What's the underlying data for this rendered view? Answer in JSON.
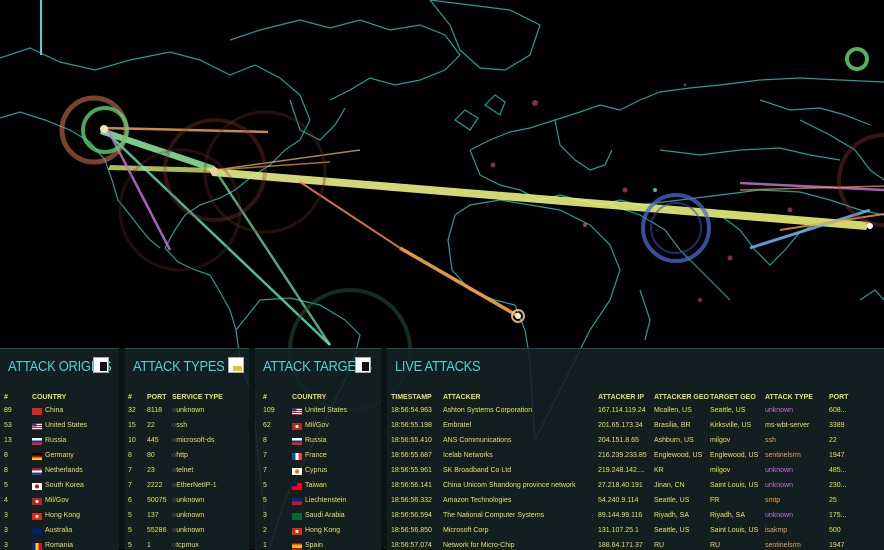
{
  "panels": {
    "origins": {
      "title": "ATTACK ORIGINS",
      "headers": [
        "#",
        "COUNTRY"
      ],
      "rows": [
        {
          "count": "89",
          "country": "China",
          "flag": "cn"
        },
        {
          "count": "53",
          "country": "United States",
          "flag": "us"
        },
        {
          "count": "13",
          "country": "Russia",
          "flag": "ru"
        },
        {
          "count": "8",
          "country": "Germany",
          "flag": "de"
        },
        {
          "count": "8",
          "country": "Netherlands",
          "flag": "nl"
        },
        {
          "count": "5",
          "country": "South Korea",
          "flag": "kr"
        },
        {
          "count": "4",
          "country": "Mil/Gov",
          "flag": "mil"
        },
        {
          "count": "3",
          "country": "Hong Kong",
          "flag": "hk"
        },
        {
          "count": "3",
          "country": "Australia",
          "flag": "au"
        },
        {
          "count": "3",
          "country": "Romania",
          "flag": "ro"
        }
      ]
    },
    "types": {
      "title": "ATTACK TYPES",
      "headers": [
        "#",
        "PORT",
        "SERVICE TYPE"
      ],
      "rows": [
        {
          "count": "32",
          "port": "8118",
          "service": "unknown"
        },
        {
          "count": "15",
          "port": "22",
          "service": "ssh"
        },
        {
          "count": "10",
          "port": "445",
          "service": "microsoft-ds"
        },
        {
          "count": "8",
          "port": "80",
          "service": "http"
        },
        {
          "count": "7",
          "port": "23",
          "service": "telnet"
        },
        {
          "count": "7",
          "port": "2222",
          "service": "EtherNetIP-1"
        },
        {
          "count": "6",
          "port": "50075",
          "service": "unknown"
        },
        {
          "count": "5",
          "port": "137",
          "service": "unknown"
        },
        {
          "count": "5",
          "port": "55286",
          "service": "unknown"
        },
        {
          "count": "5",
          "port": "1",
          "service": "tcpmux"
        }
      ]
    },
    "targets": {
      "title": "ATTACK TARGETS",
      "headers": [
        "#",
        "COUNTRY"
      ],
      "rows": [
        {
          "count": "109",
          "country": "United States",
          "flag": "us"
        },
        {
          "count": "62",
          "country": "Mil/Gov",
          "flag": "mil"
        },
        {
          "count": "8",
          "country": "Russia",
          "flag": "ru"
        },
        {
          "count": "7",
          "country": "France",
          "flag": "fr"
        },
        {
          "count": "7",
          "country": "Cyprus",
          "flag": "cy"
        },
        {
          "count": "5",
          "country": "Taiwan",
          "flag": "tw"
        },
        {
          "count": "5",
          "country": "Liechtenstein",
          "flag": "li"
        },
        {
          "count": "3",
          "country": "Saudi Arabia",
          "flag": "sa"
        },
        {
          "count": "2",
          "country": "Hong Kong",
          "flag": "hk"
        },
        {
          "count": "1",
          "country": "Spain",
          "flag": "es"
        }
      ]
    },
    "live": {
      "title": "LIVE ATTACKS",
      "headers": [
        "TIMESTAMP",
        "ATTACKER",
        "ATTACKER IP",
        "ATTACKER GEO",
        "TARGET GEO",
        "ATTACK TYPE",
        "PORT"
      ],
      "rows": [
        {
          "ts": "18:56:54.963",
          "attacker": "Ashton Systems Corporation",
          "ip": "167.114.119.24",
          "ageo": "Mcallen, US",
          "tgeo": "Seattle, US",
          "type": "unknown",
          "port": "608..."
        },
        {
          "ts": "18:56:55.198",
          "attacker": "Embratel",
          "ip": "201.65.173.34",
          "ageo": "Brasilia, BR",
          "tgeo": "Kirksville, US",
          "type": "ms-wbt-server",
          "port": "3389"
        },
        {
          "ts": "18:56:55.410",
          "attacker": "ANS Communications",
          "ip": "204.151.8.65",
          "ageo": "Ashburn, US",
          "tgeo": "milgov",
          "type": "ssh",
          "port": "22"
        },
        {
          "ts": "18:56:55.687",
          "attacker": "Icelab Networks",
          "ip": "216.239.233.85",
          "ageo": "Englewood, US",
          "tgeo": "Englewood, US",
          "type": "sentinelsrm",
          "port": "1947"
        },
        {
          "ts": "18:56:55.961",
          "attacker": "SK Broadband Co Ltd",
          "ip": "219.248.142....",
          "ageo": "KR",
          "tgeo": "milgov",
          "type": "unknown",
          "port": "485..."
        },
        {
          "ts": "18:56:56.141",
          "attacker": "China Unicom Shandong province network",
          "ip": "27.218.40.191",
          "ageo": "Jinan, CN",
          "tgeo": "Saint Louis, US",
          "type": "unknown",
          "port": "230..."
        },
        {
          "ts": "18:56:56.332",
          "attacker": "Amazon Technologies",
          "ip": "54.240.9.114",
          "ageo": "Seattle, US",
          "tgeo": "FR",
          "type": "smtp",
          "port": "25"
        },
        {
          "ts": "18:56:56.594",
          "attacker": "The National Computer Systems",
          "ip": "89.144.99.116",
          "ageo": "Riyadh, SA",
          "tgeo": "Riyadh, SA",
          "type": "unknown",
          "port": "175..."
        },
        {
          "ts": "18:56:56.850",
          "attacker": "Microsoft Corp",
          "ip": "131.107.25.1",
          "ageo": "Seattle, US",
          "tgeo": "Saint Louis, US",
          "type": "isakmp",
          "port": "500"
        },
        {
          "ts": "18:56:57.074",
          "attacker": "Network for Micro-Chip",
          "ip": "188.64.171.37",
          "ageo": "RU",
          "tgeo": "RU",
          "type": "sentinelsrm",
          "port": "1947"
        }
      ]
    }
  },
  "colors": {
    "accent": "#4fd1d9",
    "text": "#e9e25a",
    "type_unknown": "#c86fd6",
    "type_known": "#f0a050",
    "type_wbt": "#e9e25a",
    "map_lines": "#2fb7b0"
  }
}
